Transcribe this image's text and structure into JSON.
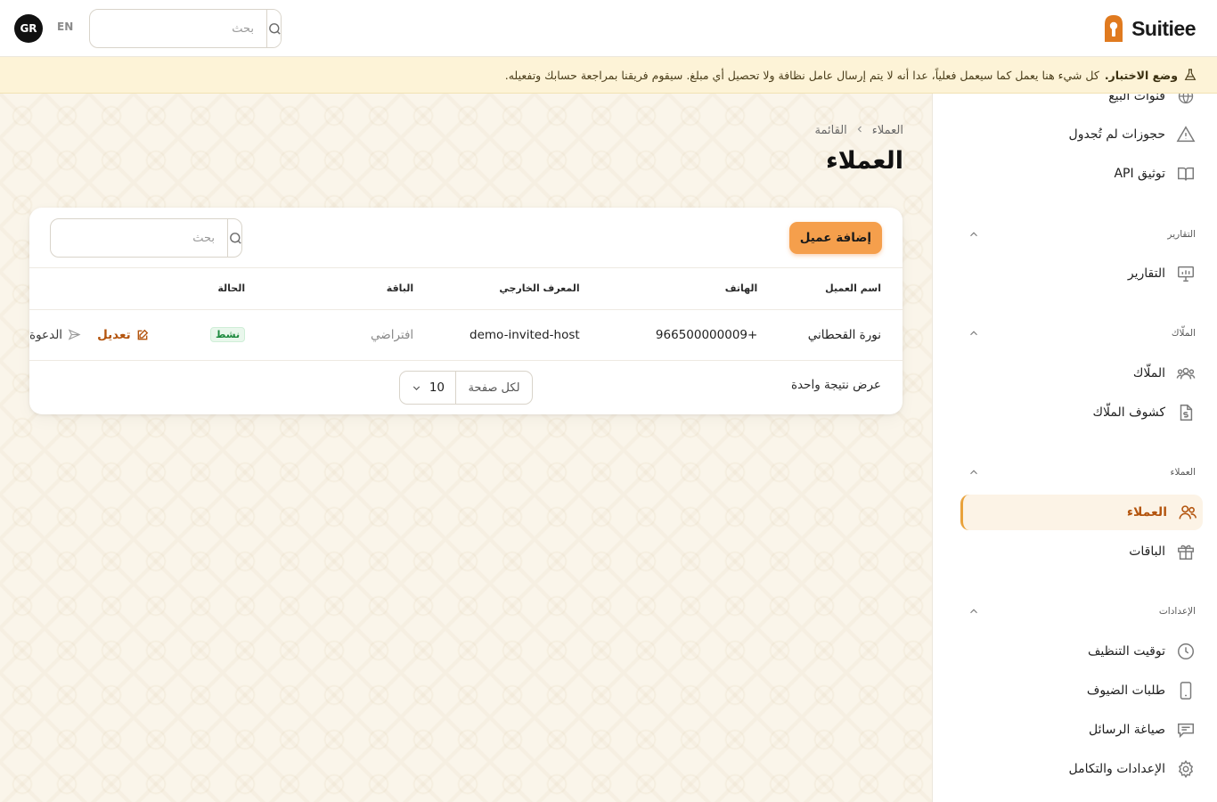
{
  "header": {
    "brand": "Suitiee",
    "avatar_initials": "GR",
    "language": "EN",
    "search_placeholder": "بحث"
  },
  "banner": {
    "label": "وضع الاختبار.",
    "message": "كل شيء هنا يعمل كما سيعمل فعلياً، عدا أنه لا يتم إرسال عامل نظافة ولا تحصيل أي مبلغ. سيقوم فريقنا بمراجعة حسابك وتفعيله."
  },
  "sidebar": {
    "top_items": [
      {
        "label": "قنوات البيع",
        "icon": "globe-icon"
      },
      {
        "label": "حجوزات لم تُجدول",
        "icon": "warning-icon"
      },
      {
        "label": "توثيق API",
        "icon": "book-icon"
      }
    ],
    "groups": [
      {
        "title": "التقارير",
        "items": [
          {
            "label": "التقارير",
            "icon": "presentation-chart-icon"
          }
        ]
      },
      {
        "title": "الملّاك",
        "items": [
          {
            "label": "الملّاك",
            "icon": "users-icon"
          },
          {
            "label": "كشوف الملّاك",
            "icon": "dollar-document-icon"
          }
        ]
      },
      {
        "title": "العملاء",
        "items": [
          {
            "label": "العملاء",
            "icon": "customers-icon"
          },
          {
            "label": "الباقات",
            "icon": "gift-icon"
          }
        ]
      },
      {
        "title": "الإعدادات",
        "items": [
          {
            "label": "توقيت التنظيف",
            "icon": "clock-icon"
          },
          {
            "label": "طلبات الضيوف",
            "icon": "phone-device-icon"
          },
          {
            "label": "صياغة الرسائل",
            "icon": "message-icon"
          },
          {
            "label": "الإعدادات والتكامل",
            "icon": "gear-icon"
          }
        ]
      }
    ]
  },
  "breadcrumb": {
    "parent": "العملاء",
    "current": "القائمة"
  },
  "page": {
    "title": "العملاء"
  },
  "toolbar": {
    "add_label": "إضافة عميل",
    "search_placeholder": "بحث"
  },
  "table": {
    "columns": {
      "name": "اسم العميل",
      "phone": "الهاتف",
      "external_id": "المعرف الخارجي",
      "plan": "الباقة",
      "status": "الحالة"
    },
    "rows": [
      {
        "name": "نورة القحطاني",
        "phone": "966500000009+",
        "external_id": "demo-invited-host",
        "plan": "افتراضي",
        "status": "نشط",
        "edit_label": "تعديل",
        "invite_label": "الدعوة"
      }
    ]
  },
  "footer": {
    "result_text": "عرض نتيجة واحدة",
    "per_page_label": "لكل صفحة",
    "per_page_value": "10"
  },
  "colors": {
    "accent": "#f59f4c",
    "accent_text": "#b4550f",
    "status_active": "#1d8a3e",
    "banner_bg": "#fdf3d7"
  }
}
